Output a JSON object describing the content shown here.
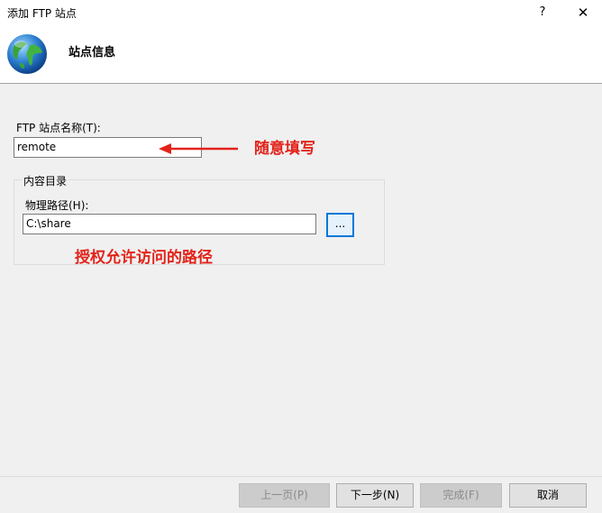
{
  "window": {
    "title": "添加 FTP 站点",
    "help_label": "?",
    "close_label": "✕"
  },
  "header": {
    "title": "站点信息",
    "icon": "globe-icon"
  },
  "form": {
    "site_name_label": "FTP 站点名称(T):",
    "site_name_value": "remote",
    "content_group_label": "内容目录",
    "physical_path_label": "物理路径(H):",
    "physical_path_value": "C:\\share",
    "browse_label": "..."
  },
  "annotations": {
    "site_name_note": "随意填写",
    "path_note": "授权允许访问的路径",
    "color": "#e2231a"
  },
  "footer": {
    "prev_label": "上一页(P)",
    "next_label": "下一步(N)",
    "finish_label": "完成(F)",
    "cancel_label": "取消"
  }
}
